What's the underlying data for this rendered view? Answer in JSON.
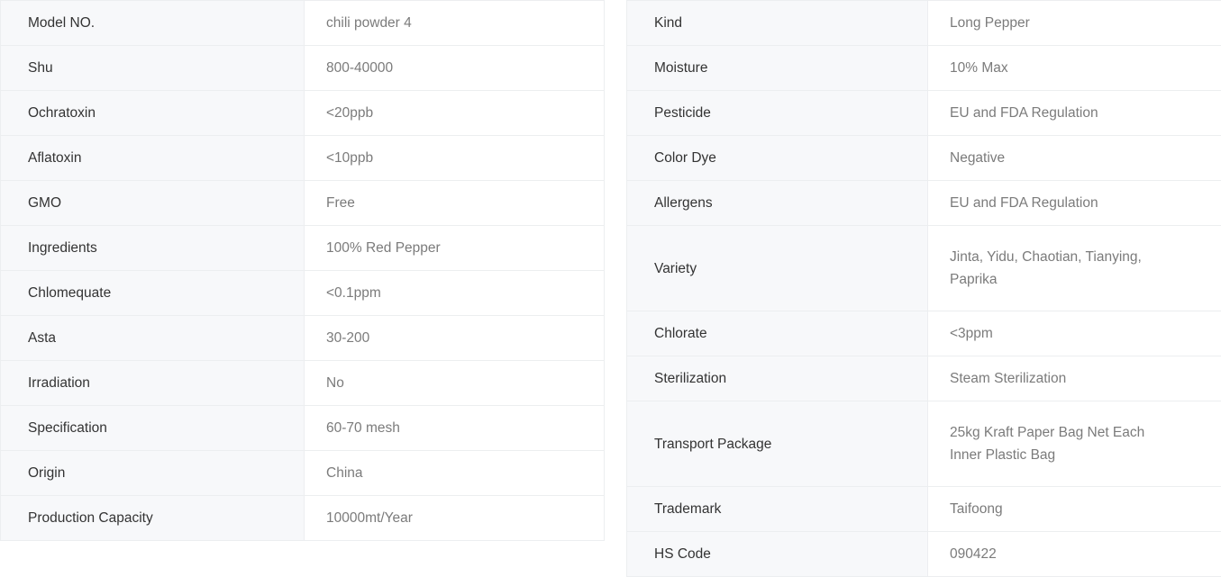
{
  "page": {
    "title": "Product Specification Tables",
    "colors": {
      "label_background": "#f7f8fa",
      "value_background": "#ffffff",
      "border": "#eceef0",
      "label_text": "#333333",
      "value_text": "#7b7b7b"
    }
  },
  "left_table": {
    "name": "product-attributes-left",
    "rows": [
      {
        "label": "Model NO.",
        "value": "chili powder 4"
      },
      {
        "label": "Shu",
        "value": "800-40000"
      },
      {
        "label": "Ochratoxin",
        "value": "<20ppb"
      },
      {
        "label": "Aflatoxin",
        "value": "<10ppb"
      },
      {
        "label": "GMO",
        "value": "Free"
      },
      {
        "label": "Ingredients",
        "value": "100% Red Pepper"
      },
      {
        "label": "Chlomequate",
        "value": "<0.1ppm"
      },
      {
        "label": "Asta",
        "value": "30-200"
      },
      {
        "label": "Irradiation",
        "value": "No"
      },
      {
        "label": "Specification",
        "value": "60-70 mesh"
      },
      {
        "label": "Origin",
        "value": "China"
      },
      {
        "label": "Production Capacity",
        "value": "10000mt/Year"
      }
    ]
  },
  "right_table": {
    "name": "product-attributes-right",
    "rows": [
      {
        "label": "Kind",
        "value": "Long Pepper"
      },
      {
        "label": "Moisture",
        "value": "10% Max"
      },
      {
        "label": "Pesticide",
        "value": "EU and FDA Regulation"
      },
      {
        "label": "Color Dye",
        "value": "Negative"
      },
      {
        "label": "Allergens",
        "value": "EU and FDA Regulation"
      },
      {
        "label": "Variety",
        "value": "Jinta, Yidu, Chaotian, Tianying,\nPaprika"
      },
      {
        "label": "Chlorate",
        "value": "<3ppm"
      },
      {
        "label": "Sterilization",
        "value": "Steam Sterilization"
      },
      {
        "label": "Transport Package",
        "value": "25kg Kraft Paper Bag Net Each\nInner Plastic Bag"
      },
      {
        "label": "Trademark",
        "value": "Taifoong"
      },
      {
        "label": "HS Code",
        "value": "090422"
      }
    ]
  }
}
